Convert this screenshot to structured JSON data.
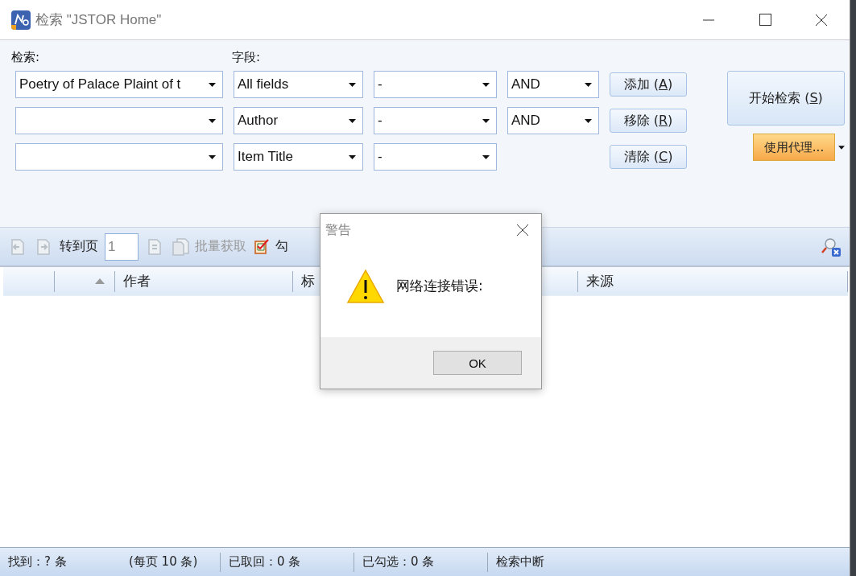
{
  "window": {
    "title": "检索 \"JSTOR Home\""
  },
  "search_label": "检索:",
  "field_label": "字段:",
  "rows": [
    {
      "query": "Poetry of Palace Plaint of t",
      "field": "All fields",
      "modifier": "-",
      "operator": "AND"
    },
    {
      "field": "Author",
      "modifier": "-",
      "operator": "AND"
    },
    {
      "field": "Item Title",
      "modifier": "-"
    }
  ],
  "row_buttons": [
    {
      "before": "添加 (",
      "key": "A",
      "after": ")"
    },
    {
      "before": "移除 (",
      "key": "R",
      "after": ")"
    },
    {
      "before": "清除 (",
      "key": "C",
      "after": ")"
    }
  ],
  "search_button": {
    "before": "开始检索 (",
    "key": "S",
    "after": ")"
  },
  "proxy_button": {
    "label": "使用代理..."
  },
  "toolbar": [
    {
      "kind": "prev-page",
      "disabled": true
    },
    {
      "kind": "next-page",
      "disabled": true
    },
    {
      "kind": "label",
      "label": "转到页"
    },
    {
      "kind": "page-field",
      "value": "1"
    },
    {
      "kind": "last-page",
      "disabled": true
    },
    {
      "kind": "fetch",
      "label": "批量获取",
      "disabled": true
    },
    {
      "kind": "check",
      "label": "勾",
      "disabled": false
    }
  ],
  "table": {
    "columns": [
      {
        "sorted": false
      },
      {
        "sorted": true
      },
      {
        "label": "作者",
        "sorted": false
      },
      {
        "label": "标",
        "sorted": false
      },
      {
        "label": "来源",
        "sorted": false
      }
    ]
  },
  "status_bar": [
    "找到：? 条",
    "(每页 10 条)",
    "已取回：0 条",
    "已勾选：0 条",
    "检索中断"
  ],
  "dialog": {
    "title": "警告",
    "message": "网络连接错误:",
    "button": "OK"
  }
}
